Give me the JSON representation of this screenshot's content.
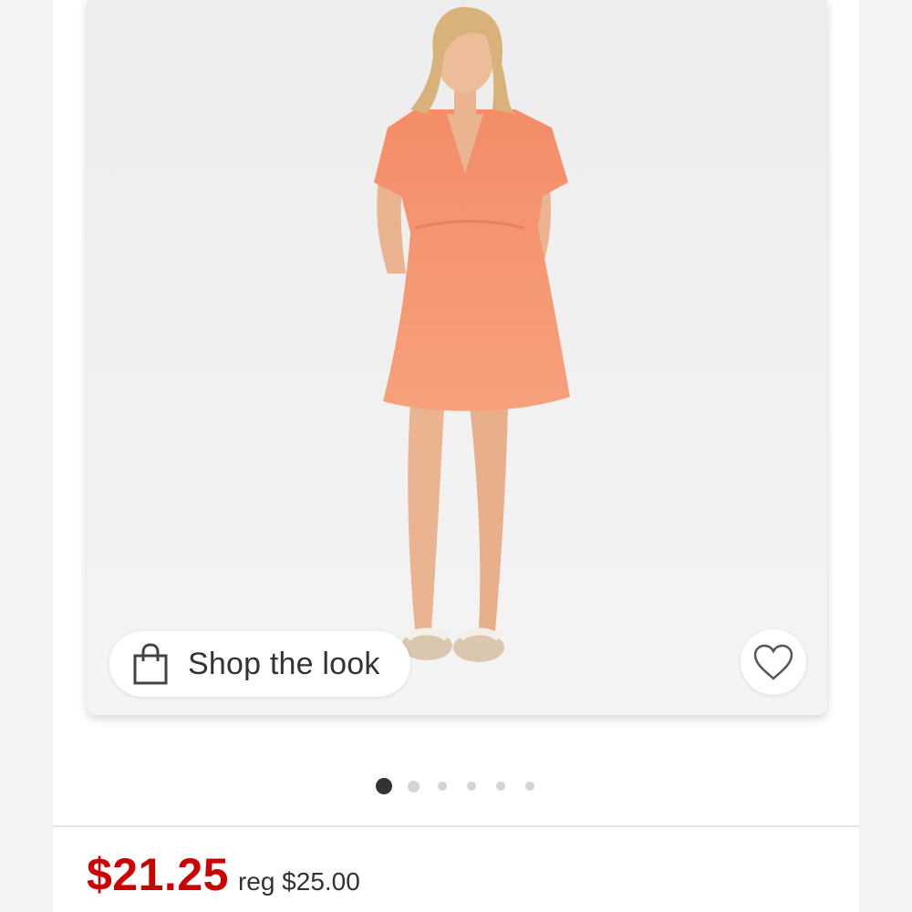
{
  "product": {
    "image_alt": "Woman wearing a short-sleeve coral mini dress with beige sandals",
    "shop_the_look_label": "Shop the look",
    "favorite_icon": "heart-outline-icon",
    "bag_icon": "shopping-bag-icon",
    "carousel": {
      "total_images": 6,
      "active_index": 0
    },
    "price": "$21.25",
    "regular_price": "reg $25.00"
  },
  "colors": {
    "sale_price": "#cc0000",
    "dress": "#f4926d",
    "background": "#efefef",
    "active_dot": "#333333",
    "inactive_dot": "#d4d4d4"
  }
}
